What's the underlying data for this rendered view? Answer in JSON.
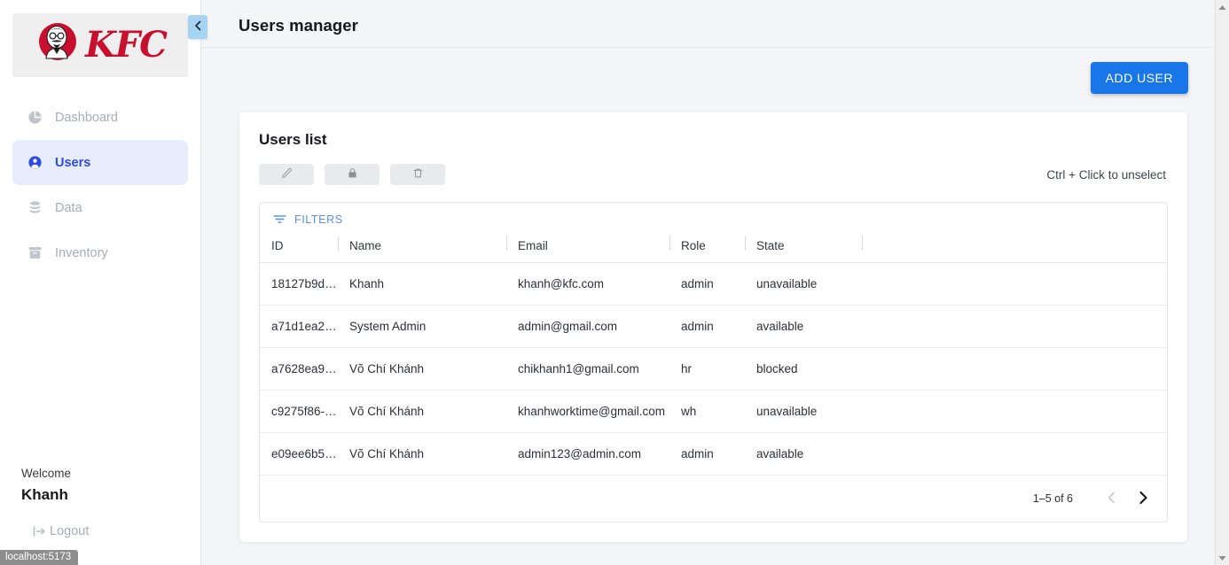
{
  "brand": {
    "name": "KFC",
    "logo_icon": "kfc-colonel-logo",
    "red": "#c8102e"
  },
  "colors": {
    "accent_blue": "#1976e8",
    "active_nav_bg": "#e8edfd",
    "active_nav_text": "#2f4ce0",
    "page_bg": "#f4f5f7",
    "filters_blue": "#5b8def"
  },
  "sidebar": {
    "collapse_toggle_icon": "chevron-left-icon",
    "items": [
      {
        "label": "Dashboard",
        "icon": "pie-chart-icon",
        "active": false
      },
      {
        "label": "Users",
        "icon": "user-circle-icon",
        "active": true
      },
      {
        "label": "Data",
        "icon": "database-icon",
        "active": false
      },
      {
        "label": "Inventory",
        "icon": "inventory-box-icon",
        "active": false
      }
    ],
    "footer": {
      "welcome_label": "Welcome",
      "user_name": "Khanh",
      "logout_label": "Logout",
      "logout_icon": "logout-arrow-icon"
    }
  },
  "header": {
    "title": "Users manager"
  },
  "toolbar": {
    "add_user_label": "ADD USER"
  },
  "card": {
    "title": "Users list",
    "hint": "Ctrl + Click to unselect",
    "actions": [
      {
        "name": "edit",
        "icon": "pencil-icon",
        "disabled": true
      },
      {
        "name": "lock",
        "icon": "lock-icon",
        "disabled": true
      },
      {
        "name": "delete",
        "icon": "trash-icon",
        "disabled": true
      }
    ]
  },
  "filters": {
    "label": "FILTERS",
    "icon": "filter-funnel-icon"
  },
  "table": {
    "columns": [
      "ID",
      "Name",
      "Email",
      "Role",
      "State",
      ""
    ],
    "rows": [
      {
        "id": "18127b9d…",
        "name": "Khanh",
        "email": "khanh@kfc.com",
        "role": "admin",
        "state": "unavailable"
      },
      {
        "id": "a71d1ea2…",
        "name": "System Admin",
        "email": "admin@gmail.com",
        "role": "admin",
        "state": "available"
      },
      {
        "id": "a7628ea9…",
        "name": "Võ Chí Khánh",
        "email": "chikhanh1@gmail.com",
        "role": "hr",
        "state": "blocked"
      },
      {
        "id": "c9275f86-…",
        "name": "Võ Chí Khánh",
        "email": "khanhworktime@gmail.com",
        "role": "wh",
        "state": "unavailable"
      },
      {
        "id": "e09ee6b5…",
        "name": "Võ Chí Khánh",
        "email": "admin123@admin.com",
        "role": "admin",
        "state": "available"
      }
    ]
  },
  "pagination": {
    "range_label": "1–5 of 6",
    "prev_icon": "chevron-left-icon",
    "next_icon": "chevron-right-icon",
    "prev_disabled": true,
    "next_disabled": false
  },
  "status_bar": {
    "text": "localhost:5173"
  }
}
